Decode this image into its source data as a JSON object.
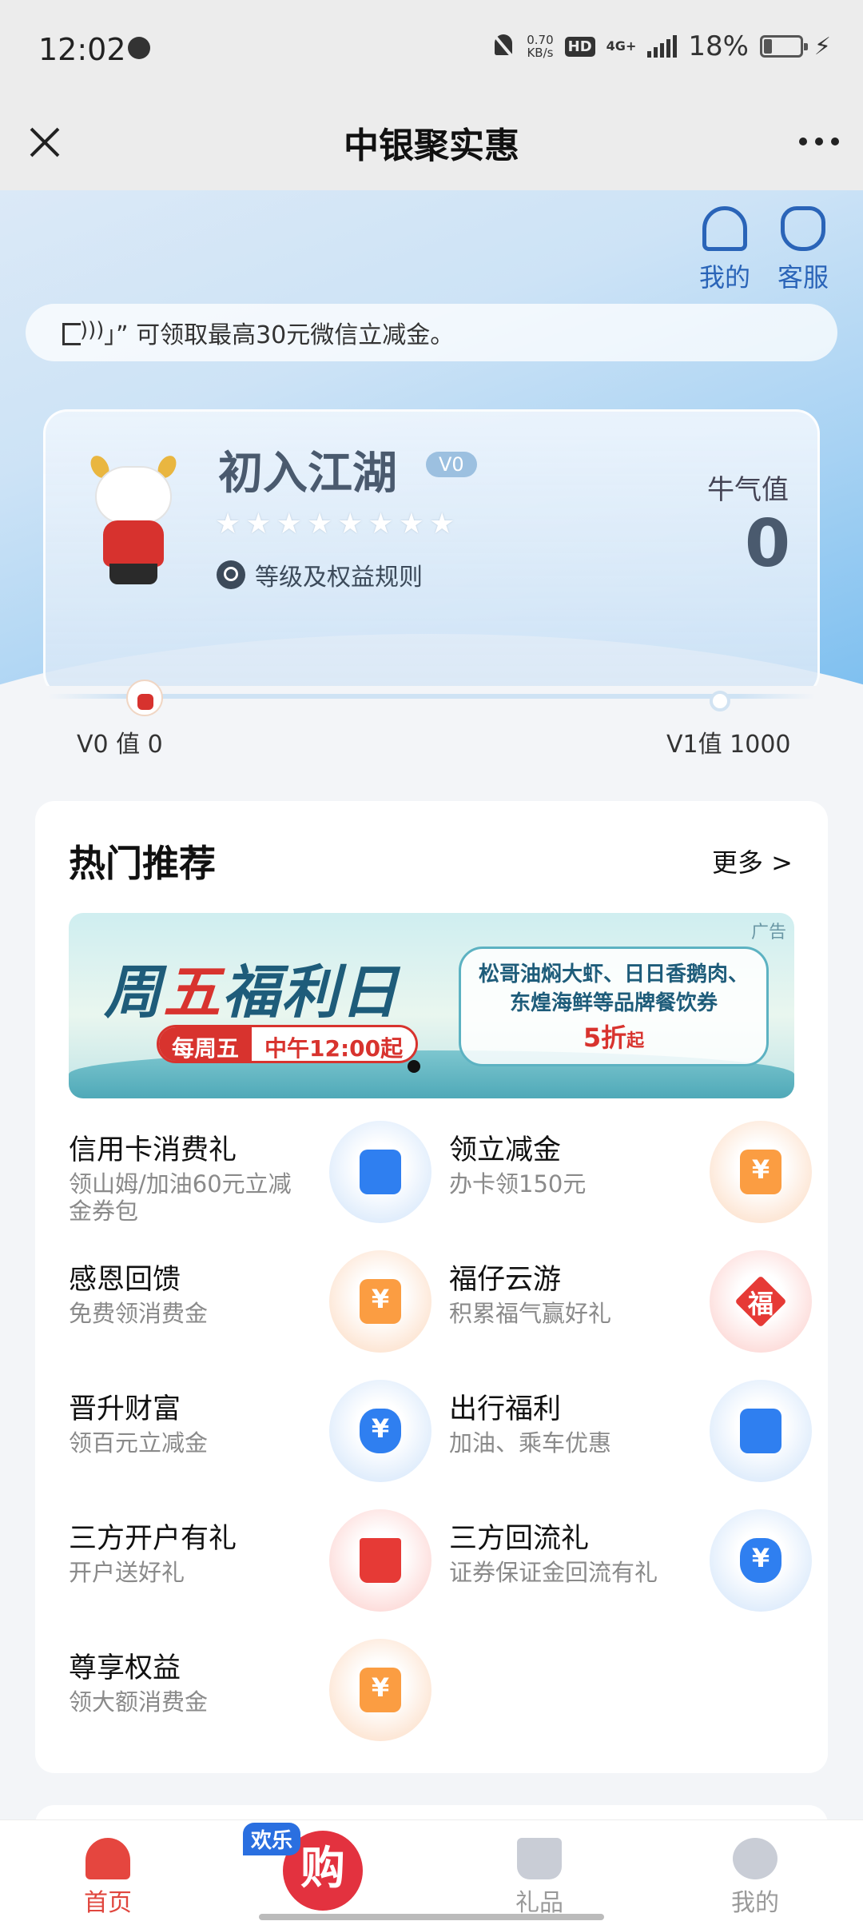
{
  "status_bar": {
    "time": "12:02",
    "speed_value": "0.70",
    "speed_unit": "KB/s",
    "hd": "HD",
    "network": "4G+",
    "battery": "18%"
  },
  "title_bar": {
    "title": "中银聚实惠"
  },
  "hero": {
    "mine_label": "我的",
    "service_label": "客服",
    "notice": "」” 可领取最高30元微信立减金。",
    "level_name": "初入江湖",
    "level_badge": "V0",
    "stars": [
      "★",
      "★",
      "★",
      "★",
      "★",
      "★",
      "★",
      "★"
    ],
    "rules_label": "等级及权益规则",
    "qi_label": "牛气值",
    "qi_value": "0"
  },
  "progress": {
    "left_label": "V0 值 0",
    "right_label": "V1值 1000"
  },
  "hot": {
    "title": "热门推荐",
    "more": "更多 >",
    "banner": {
      "ad_label": "广告",
      "title_part1": "周",
      "title_part2": "五",
      "title_part3": "福利日",
      "pill_left": "每周五",
      "pill_right": "中午12:00起",
      "bubble_line1": "松哥油焖大虾、日日香鹅肉、",
      "bubble_line2": "东煌海鲜等品牌餐饮券",
      "discount": "5折",
      "discount_suffix": "起"
    },
    "items": [
      {
        "title": "信用卡消费礼",
        "subtitle": "领山姆/加油60元立减金券包",
        "icon": "shopping-bag-icon"
      },
      {
        "title": "领立减金",
        "subtitle": "办卡领150元",
        "icon": "yuan-coupon-icon"
      },
      {
        "title": "感恩回馈",
        "subtitle": "免费领消费金",
        "icon": "yuan-coupon-icon"
      },
      {
        "title": "福仔云游",
        "subtitle": "积累福气赢好礼",
        "icon": "fu-diamond-icon"
      },
      {
        "title": "晋升财富",
        "subtitle": "领百元立减金",
        "icon": "money-bag-icon"
      },
      {
        "title": "出行福利",
        "subtitle": "加油、乘车优惠",
        "icon": "shopping-bag-icon"
      },
      {
        "title": "三方开户有礼",
        "subtitle": "开户送好礼",
        "icon": "crown-icon"
      },
      {
        "title": "三方回流礼",
        "subtitle": "证券保证金回流有礼",
        "icon": "money-bag-icon"
      },
      {
        "title": "尊享权益",
        "subtitle": "领大额消费金",
        "icon": "yuan-coupon-icon"
      }
    ]
  },
  "bottom_nav": {
    "home": "首页",
    "center_badge": "欢乐",
    "center_glyph": "购",
    "gift": "礼品",
    "mine": "我的"
  },
  "colors": {
    "accent_blue": "#2f7ff0",
    "accent_red": "#e0463e",
    "accent_orange": "#fb9d42"
  }
}
